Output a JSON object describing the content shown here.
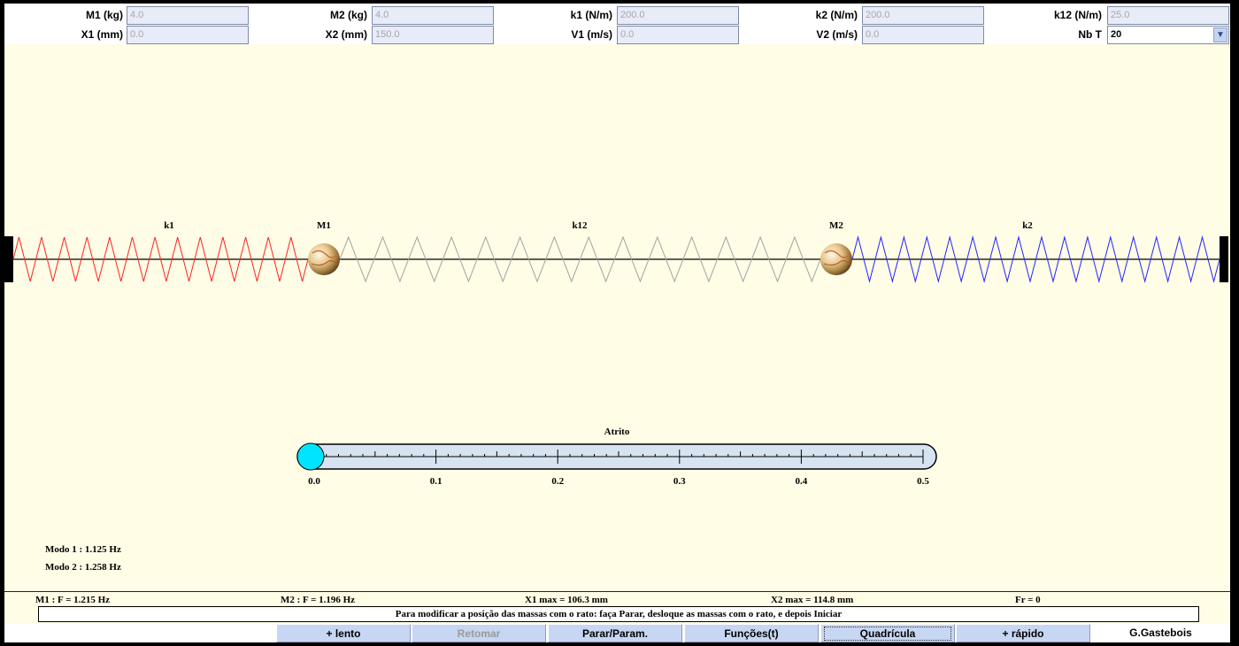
{
  "params": {
    "row1": [
      {
        "label": "M1 (kg)",
        "value": "4.0"
      },
      {
        "label": "M2 (kg)",
        "value": "4.0"
      },
      {
        "label": "k1 (N/m)",
        "value": "200.0"
      },
      {
        "label": "k2 (N/m)",
        "value": "200.0"
      },
      {
        "label": "k12 (N/m)",
        "value": "25.0"
      }
    ],
    "row2": [
      {
        "label": "X1 (mm)",
        "value": "0.0"
      },
      {
        "label": "X2 (mm)",
        "value": "150.0"
      },
      {
        "label": "V1 (m/s)",
        "value": "0.0"
      },
      {
        "label": "V2 (m/s)",
        "value": "0.0"
      },
      {
        "label": "Nb T",
        "value": "20"
      }
    ]
  },
  "scene": {
    "k1_label": "k1",
    "m1_label": "M1",
    "k12_label": "k12",
    "m2_label": "M2",
    "k2_label": "k2",
    "spring_colors": {
      "k1": "#ff2020",
      "k12": "#a0a0a0",
      "k2": "#2424ff"
    }
  },
  "friction": {
    "title": "Atrito",
    "value": 0.0,
    "min": 0.0,
    "max": 0.5,
    "tick_labels": [
      "0.0",
      "0.1",
      "0.2",
      "0.3",
      "0.4",
      "0.5"
    ],
    "knob_color": "#00e5ff"
  },
  "modes": {
    "modo1": "Modo 1 : 1.125 Hz",
    "modo2": "Modo 2 : 1.258 Hz"
  },
  "status": {
    "m1_freq": "M1 : F = 1.215 Hz",
    "m2_freq": "M2 : F = 1.196 Hz",
    "x1_max": "X1 max = 106.3 mm",
    "x2_max": "X2 max = 114.8 mm",
    "fr": "Fr = 0"
  },
  "message": "Para modificar a posição das massas com o rato: faça Parar, desloque as massas com o rato, e depois Iniciar",
  "buttons": {
    "slower": "+ lento",
    "resume": "Retomar",
    "stop": "Parar/Param.",
    "functions": "Funções(t)",
    "grid": "Quadrícula",
    "faster": "+ rápido"
  },
  "author": "G.Gastebois"
}
